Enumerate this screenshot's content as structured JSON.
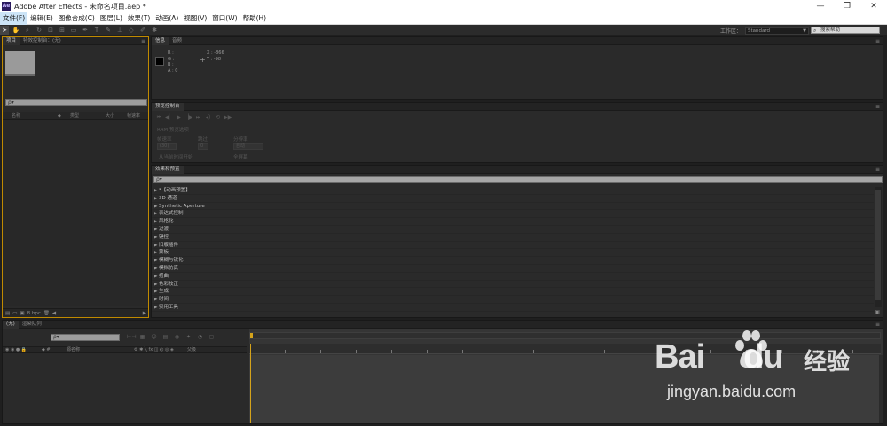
{
  "window": {
    "app_icon": "Ae",
    "title": "Adobe After Effects - 未命名项目.aep *",
    "controls": [
      "—",
      "❐",
      "✕"
    ]
  },
  "menu": {
    "items": [
      "文件(F)",
      "编辑(E)",
      "图像合成(C)",
      "图层(L)",
      "效果(T)",
      "动画(A)",
      "视图(V)",
      "窗口(W)",
      "帮助(H)"
    ]
  },
  "toolbar": {
    "workspace_label": "工作区：",
    "workspace_value": "Standard",
    "search_help_placeholder": "搜索帮助"
  },
  "project_panel": {
    "tabs": [
      "项目",
      "特效控制台：(无)"
    ],
    "search_placeholder": "ρ▾",
    "columns": [
      "名称",
      "标签",
      "类型",
      "大小",
      "帧速率"
    ],
    "footer_bpc": "8 bpc"
  },
  "info_panel": {
    "tabs": [
      "信息",
      "音频"
    ],
    "rgba_lines": [
      "R :",
      "G :",
      "B :",
      "A : 0"
    ],
    "coord_lines": [
      "X : -866",
      "Y : -98"
    ]
  },
  "preview_panel": {
    "tab": "预览控制台",
    "ram_label": "RAM 预览选项",
    "frame_rate_label": "帧速率",
    "skip_label": "跳过",
    "resolution_label": "分辨率",
    "frame_rate_value": "(30)",
    "skip_value": "0",
    "resolution_value": "自动",
    "from_current_label": "从当前时间开始",
    "fullscreen_label": "全屏幕"
  },
  "effects_panel": {
    "tab": "效果和预置",
    "search_placeholder": "ρ▾",
    "items": [
      "*【动画预置】",
      "3D 通道",
      "Synthetic Aperture",
      "表达式控制",
      "风格化",
      "过渡",
      "键控",
      "旧版插件",
      "蒙板",
      "模糊与锐化",
      "模拟仿真",
      "扭曲",
      "色彩校正",
      "生成",
      "时间",
      "实用工具"
    ]
  },
  "timeline_panel": {
    "tabs": [
      "(无)",
      "渲染队列"
    ],
    "search_placeholder": "ρ▾",
    "columns": [
      "源名称",
      "父级"
    ]
  },
  "watermark": {
    "logo_text": "Bai",
    "logo_text2": "du",
    "chinese": "经验",
    "url": "jingyan.baidu.com"
  }
}
